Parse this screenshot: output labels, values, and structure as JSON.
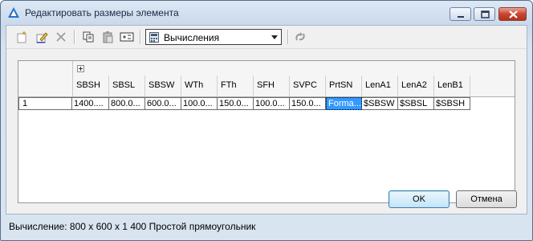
{
  "window": {
    "title": "Редактировать размеры элемента",
    "buttons": {
      "minimize": "minimize",
      "maximize": "maximize",
      "close": "close"
    }
  },
  "toolbar": {
    "combo_value": "Вычисления"
  },
  "grid": {
    "columns": [
      "SBSH",
      "SBSL",
      "SBSW",
      "WTh",
      "FTh",
      "SFH",
      "SVPC",
      "PrtSN",
      "LenA1",
      "LenA2",
      "LenB1"
    ],
    "rows": [
      {
        "num": "1",
        "cells": [
          "1400....",
          "800.0...",
          "600.0...",
          "100.0...",
          "150.0...",
          "100.0...",
          "150.0...",
          "Forma...",
          "$SBSW",
          "$SBSL",
          "$SBSH"
        ]
      }
    ]
  },
  "dialog": {
    "ok_label": "OK",
    "cancel_label": "Отмена"
  },
  "status": {
    "text": "Вычисление: 800 x 600 x 1 400 Простой прямоугольник"
  },
  "colors": {
    "selection": "#3399ff",
    "title_bg": "#c9d9ec"
  }
}
